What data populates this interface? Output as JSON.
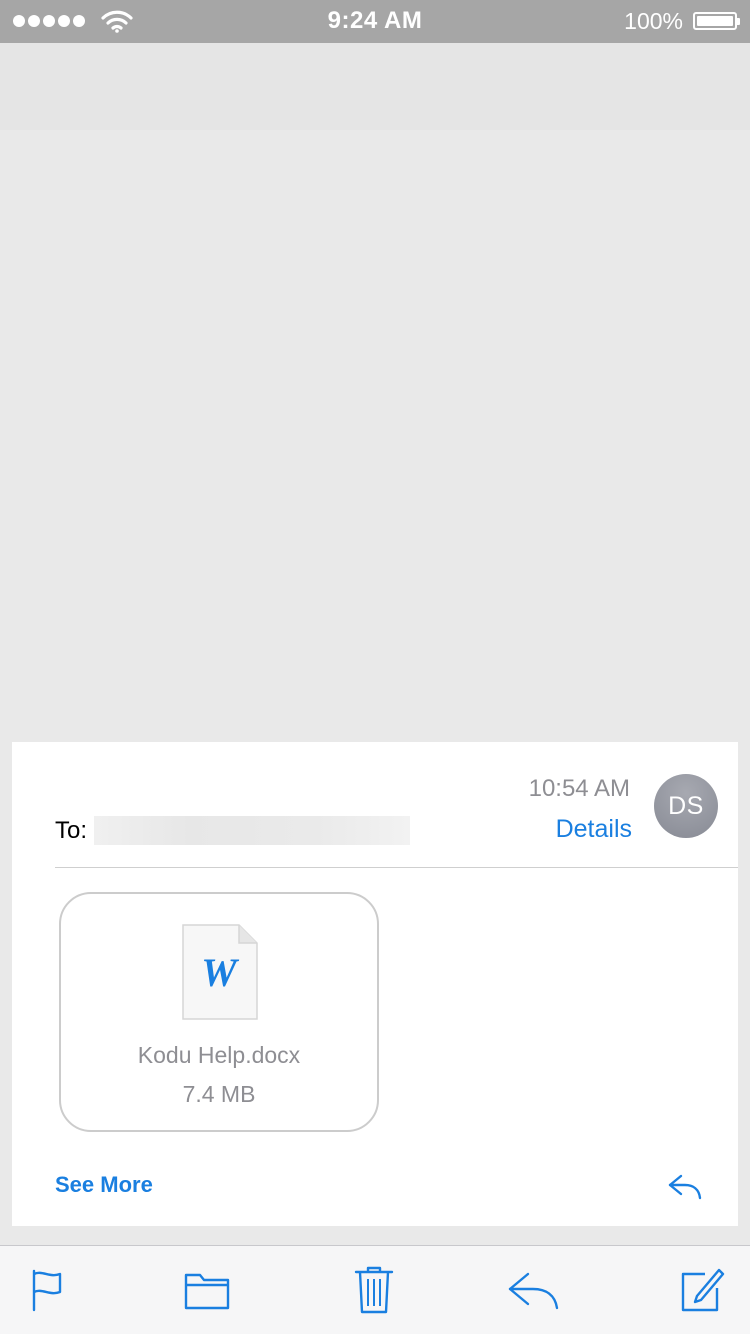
{
  "status_bar": {
    "time": "9:24 AM",
    "battery_percent": "100%",
    "signal_bars": 5,
    "battery_level": 1.0
  },
  "message": {
    "time": "10:54 AM",
    "details_label": "Details",
    "to_label": "To:",
    "avatar_initials": "DS",
    "attachment": {
      "name": "Kodu Help.docx",
      "size": "7.4 MB",
      "icon_letter": "W"
    },
    "see_more_label": "See More"
  },
  "toolbar": {
    "items": [
      "flag-icon",
      "folder-icon",
      "trash-icon",
      "reply-icon",
      "compose-icon"
    ]
  },
  "colors": {
    "accent": "#1a7fe0",
    "status_bar_bg": "#a6a6a6",
    "page_bg": "#e9e9e9",
    "secondary_text": "#8e8e93"
  }
}
